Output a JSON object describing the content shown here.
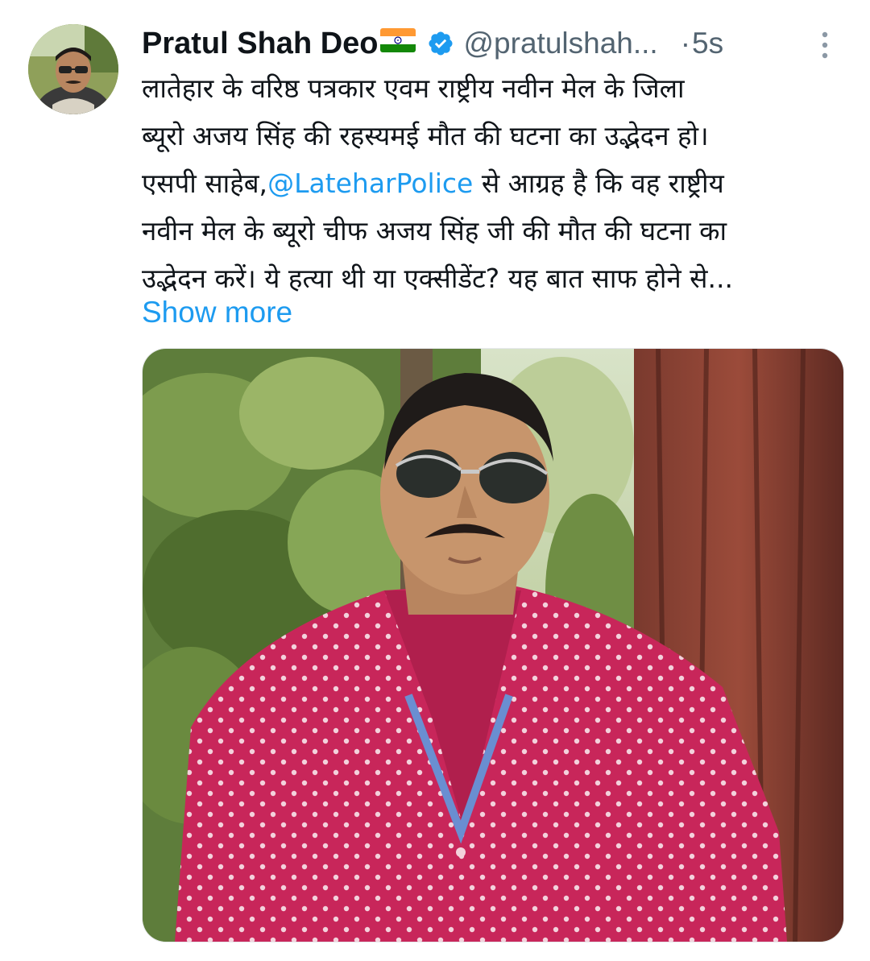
{
  "tweet": {
    "author": {
      "display_name": "Pratul Shah Deo",
      "flag": "india-flag-emoji",
      "verified": true,
      "handle": "@pratulshah...",
      "separator": "·",
      "time": "5s",
      "avatar": "profile-photo"
    },
    "body": {
      "line1": "लातेहार के वरिष्ठ पत्रकार एवम राष्ट्रीय नवीन मेल के जिला",
      "line2": "ब्यूरो अजय सिंह की रहस्यमई मौत की घटना का उद्भेदन हो।",
      "line3_prefix": "एसपी साहेब,",
      "line3_mention": "@LateharPolice",
      "line3_suffix": " से आग्रह है कि वह राष्ट्रीय",
      "line4": "नवीन मेल के ब्यूरो चीफ अजय सिंह जी की मौत की घटना का",
      "line5": "उद्भेदन करें। ये हत्या थी या एक्सीडेंट? यह बात साफ होने से..."
    },
    "show_more": "Show more",
    "media": "photo-man-sunglasses-red-polka-dot-shirt",
    "colors": {
      "text": "#0f1419",
      "secondary": "#536471",
      "accent": "#1d9bf0",
      "verified": "#1d9bf0"
    }
  }
}
